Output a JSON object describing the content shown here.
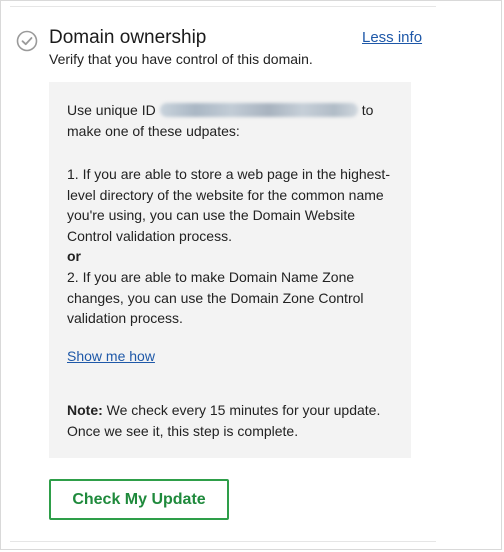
{
  "step": {
    "title": "Domain ownership",
    "subtitle": "Verify that you have control of this domain.",
    "toggle_link": "Less info",
    "check_icon": "check-circle-icon"
  },
  "panel": {
    "id_prefix": "Use unique ID",
    "id_suffix": "to",
    "line2": "make one of these udpates:",
    "option1": "1. If you are able to store a web page in the highest-level directory of the website for the common name you're using, you can use the Domain Website Control validation process.",
    "or_label": "or",
    "option2": "2. If you are able to make Domain Name Zone changes, you can use the Domain Zone Control validation process.",
    "show_me_how": "Show me how",
    "note_label": "Note:",
    "note_text": " We check every 15 minutes for your update. Once we see it, this step is complete."
  },
  "actions": {
    "check_button": "Check My Update"
  },
  "colors": {
    "link": "#1e58a8",
    "accent_green": "#2e9e49",
    "panel_bg": "#f3f3f3"
  }
}
